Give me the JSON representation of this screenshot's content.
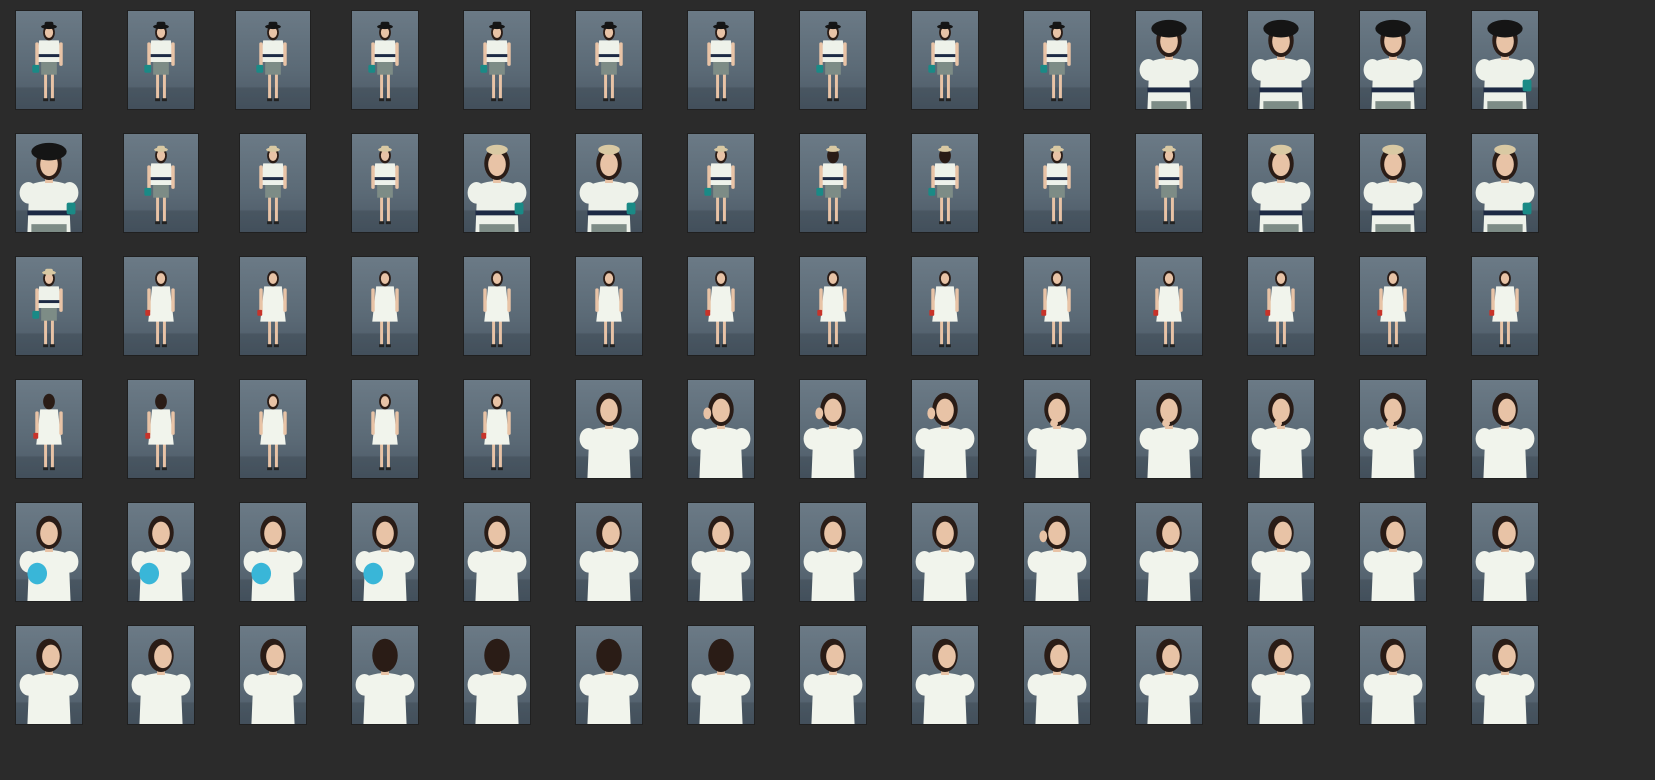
{
  "gallery": {
    "background": "#2b2b2b",
    "backdrop_color": "#5f6e7a",
    "rows": [
      [
        {
          "pose": "full",
          "outfit": "blouse",
          "hat": "black-small",
          "bag": "teal"
        },
        {
          "pose": "full",
          "outfit": "blouse",
          "hat": "black-small",
          "bag": "teal"
        },
        {
          "pose": "full-wide",
          "outfit": "blouse",
          "hat": "black-small",
          "bag": "teal"
        },
        {
          "pose": "full",
          "outfit": "blouse",
          "hat": "black-small",
          "bag": "teal"
        },
        {
          "pose": "full-side",
          "outfit": "blouse",
          "hat": "black-small",
          "bag": "teal"
        },
        {
          "pose": "full-side",
          "outfit": "blouse",
          "hat": "black-small",
          "bag": "none"
        },
        {
          "pose": "full",
          "outfit": "blouse",
          "hat": "black-small",
          "bag": "none"
        },
        {
          "pose": "full",
          "outfit": "blouse",
          "hat": "black-small",
          "bag": "teal"
        },
        {
          "pose": "full-side",
          "outfit": "blouse",
          "hat": "black-small",
          "bag": "teal"
        },
        {
          "pose": "full-side",
          "outfit": "blouse",
          "hat": "black-small",
          "bag": "teal"
        },
        {
          "pose": "half",
          "outfit": "blouse",
          "hat": "black-big",
          "bag": "none"
        },
        {
          "pose": "half",
          "outfit": "blouse",
          "hat": "black-big",
          "bag": "none"
        },
        {
          "pose": "half",
          "outfit": "blouse",
          "hat": "black-big",
          "bag": "none"
        },
        {
          "pose": "half",
          "outfit": "blouse",
          "hat": "black-big",
          "bag": "teal"
        }
      ],
      [
        {
          "pose": "half",
          "outfit": "blouse",
          "hat": "black-big",
          "bag": "teal"
        },
        {
          "pose": "full-wide",
          "outfit": "blouse",
          "hat": "straw",
          "bag": "teal"
        },
        {
          "pose": "full",
          "outfit": "blouse",
          "hat": "straw",
          "bag": "none"
        },
        {
          "pose": "full",
          "outfit": "blouse",
          "hat": "straw",
          "bag": "none"
        },
        {
          "pose": "half",
          "outfit": "blouse",
          "hat": "straw",
          "bag": "teal"
        },
        {
          "pose": "half",
          "outfit": "blouse",
          "hat": "straw",
          "bag": "teal"
        },
        {
          "pose": "full-side",
          "outfit": "blouse",
          "hat": "straw",
          "bag": "teal"
        },
        {
          "pose": "full-back",
          "outfit": "blouse",
          "hat": "straw",
          "bag": "teal"
        },
        {
          "pose": "full-back",
          "outfit": "blouse",
          "hat": "straw",
          "bag": "teal"
        },
        {
          "pose": "full-side",
          "outfit": "blouse",
          "hat": "straw",
          "bag": "none"
        },
        {
          "pose": "full-side",
          "outfit": "blouse",
          "hat": "straw",
          "bag": "none"
        },
        {
          "pose": "half",
          "outfit": "blouse",
          "hat": "straw",
          "bag": "none"
        },
        {
          "pose": "half",
          "outfit": "blouse",
          "hat": "straw",
          "bag": "none"
        },
        {
          "pose": "half",
          "outfit": "blouse",
          "hat": "straw",
          "bag": "teal"
        }
      ],
      [
        {
          "pose": "full",
          "outfit": "blouse",
          "hat": "straw",
          "bag": "teal"
        },
        {
          "pose": "full-wide",
          "outfit": "dress",
          "hat": "none",
          "bag": "red"
        },
        {
          "pose": "full",
          "outfit": "dress",
          "hat": "none",
          "bag": "red"
        },
        {
          "pose": "full",
          "outfit": "dress",
          "hat": "none",
          "bag": "none"
        },
        {
          "pose": "full",
          "outfit": "dress",
          "hat": "none",
          "bag": "none"
        },
        {
          "pose": "full",
          "outfit": "dress",
          "hat": "none",
          "bag": "none"
        },
        {
          "pose": "full",
          "outfit": "dress",
          "hat": "none",
          "bag": "red"
        },
        {
          "pose": "full-side",
          "outfit": "dress",
          "hat": "none",
          "bag": "red"
        },
        {
          "pose": "full",
          "outfit": "dress",
          "hat": "none",
          "bag": "red"
        },
        {
          "pose": "full",
          "outfit": "dress",
          "hat": "none",
          "bag": "red"
        },
        {
          "pose": "full-side",
          "outfit": "dress",
          "hat": "none",
          "bag": "red"
        },
        {
          "pose": "full",
          "outfit": "dress",
          "hat": "none",
          "bag": "red"
        },
        {
          "pose": "full",
          "outfit": "dress",
          "hat": "none",
          "bag": "red"
        },
        {
          "pose": "full-side",
          "outfit": "dress",
          "hat": "none",
          "bag": "red"
        }
      ],
      [
        {
          "pose": "full-back",
          "outfit": "dress",
          "hat": "none",
          "bag": "red"
        },
        {
          "pose": "full-back",
          "outfit": "dress",
          "hat": "none",
          "bag": "red"
        },
        {
          "pose": "full-side",
          "outfit": "dress",
          "hat": "none",
          "bag": "none"
        },
        {
          "pose": "full-side",
          "outfit": "dress",
          "hat": "none",
          "bag": "none"
        },
        {
          "pose": "full",
          "outfit": "dress",
          "hat": "none",
          "bag": "red"
        },
        {
          "pose": "portrait",
          "outfit": "dress",
          "hat": "none",
          "bag": "none"
        },
        {
          "pose": "portrait-hand",
          "outfit": "dress",
          "hat": "none",
          "bag": "none"
        },
        {
          "pose": "portrait-hand",
          "outfit": "dress",
          "hat": "none",
          "bag": "none"
        },
        {
          "pose": "portrait-hand",
          "outfit": "dress",
          "hat": "none",
          "bag": "none"
        },
        {
          "pose": "portrait-chin",
          "outfit": "dress",
          "hat": "none",
          "bag": "none"
        },
        {
          "pose": "portrait-chin",
          "outfit": "dress",
          "hat": "none",
          "bag": "none"
        },
        {
          "pose": "portrait-chin",
          "outfit": "dress",
          "hat": "none",
          "bag": "none"
        },
        {
          "pose": "portrait-chin",
          "outfit": "dress",
          "hat": "none",
          "bag": "none"
        },
        {
          "pose": "portrait-side",
          "outfit": "dress",
          "hat": "none",
          "bag": "none"
        }
      ],
      [
        {
          "pose": "portrait",
          "outfit": "dress",
          "hat": "none",
          "bag": "blue"
        },
        {
          "pose": "portrait",
          "outfit": "dress",
          "hat": "none",
          "bag": "blue"
        },
        {
          "pose": "portrait",
          "outfit": "dress",
          "hat": "none",
          "bag": "blue"
        },
        {
          "pose": "portrait",
          "outfit": "dress",
          "hat": "none",
          "bag": "blue"
        },
        {
          "pose": "portrait",
          "outfit": "dress",
          "hat": "none",
          "bag": "none"
        },
        {
          "pose": "portrait-side",
          "outfit": "dress",
          "hat": "none",
          "bag": "none"
        },
        {
          "pose": "portrait",
          "outfit": "dress",
          "hat": "none",
          "bag": "none"
        },
        {
          "pose": "portrait",
          "outfit": "dress",
          "hat": "none",
          "bag": "none"
        },
        {
          "pose": "portrait",
          "outfit": "dress",
          "hat": "none",
          "bag": "none"
        },
        {
          "pose": "portrait-hand",
          "outfit": "dress",
          "hat": "none",
          "bag": "none"
        },
        {
          "pose": "portrait-side",
          "outfit": "dress",
          "hat": "none",
          "bag": "none"
        },
        {
          "pose": "portrait-side",
          "outfit": "dress",
          "hat": "none",
          "bag": "none"
        },
        {
          "pose": "portrait-side",
          "outfit": "dress",
          "hat": "none",
          "bag": "none"
        },
        {
          "pose": "portrait-side",
          "outfit": "dress",
          "hat": "none",
          "bag": "none"
        }
      ],
      [
        {
          "pose": "portrait-side",
          "outfit": "dress",
          "hat": "none",
          "bag": "none"
        },
        {
          "pose": "portrait-side",
          "outfit": "dress",
          "hat": "none",
          "bag": "none"
        },
        {
          "pose": "portrait-side",
          "outfit": "dress",
          "hat": "none",
          "bag": "none"
        },
        {
          "pose": "portrait-back",
          "outfit": "dress",
          "hat": "none",
          "bag": "none"
        },
        {
          "pose": "portrait-back",
          "outfit": "dress",
          "hat": "none",
          "bag": "none"
        },
        {
          "pose": "portrait-back",
          "outfit": "dress",
          "hat": "none",
          "bag": "none"
        },
        {
          "pose": "portrait-back",
          "outfit": "dress",
          "hat": "none",
          "bag": "none"
        },
        {
          "pose": "portrait-side",
          "outfit": "dress",
          "hat": "none",
          "bag": "none"
        },
        {
          "pose": "portrait-side",
          "outfit": "dress",
          "hat": "none",
          "bag": "none"
        },
        {
          "pose": "portrait-side",
          "outfit": "dress",
          "hat": "none",
          "bag": "none"
        },
        {
          "pose": "portrait-side",
          "outfit": "dress",
          "hat": "none",
          "bag": "none"
        },
        {
          "pose": "portrait-side",
          "outfit": "dress",
          "hat": "none",
          "bag": "none"
        },
        {
          "pose": "portrait-side",
          "outfit": "dress",
          "hat": "none",
          "bag": "none"
        },
        {
          "pose": "portrait-side",
          "outfit": "dress",
          "hat": "none",
          "bag": "none"
        }
      ]
    ]
  },
  "colors": {
    "blouse": "#eef2ea",
    "dress": "#f1f4ec",
    "stripe": "#1d2a44",
    "shorts": "#7d8c86",
    "skin": "#e8c3a6",
    "hair": "#2a1c16",
    "hat_black": "#151515",
    "hat_straw": "#d9c9a3",
    "bag_teal": "#1a8a86",
    "bag_red": "#c8332a",
    "bag_blue": "#39b6d8"
  }
}
